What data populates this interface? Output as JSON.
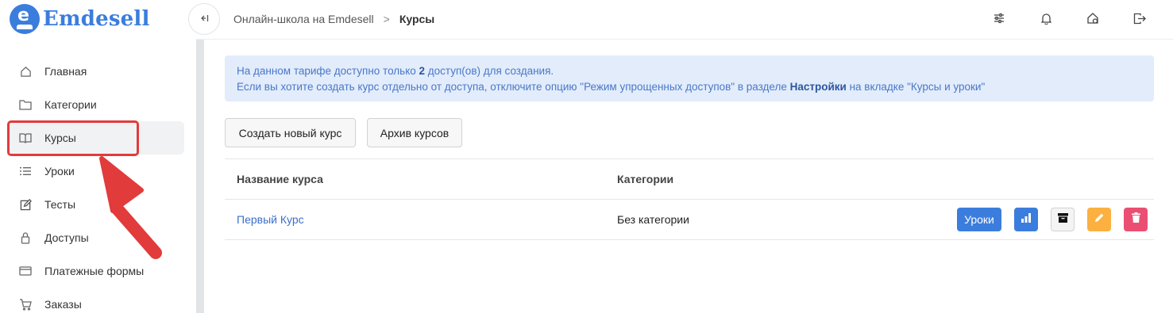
{
  "brand": {
    "name": "Emdesell",
    "mark_letter": "e",
    "color": "#3b7ddd"
  },
  "sidebar": {
    "items": [
      {
        "label": "Главная",
        "icon": "home-icon"
      },
      {
        "label": "Категории",
        "icon": "folder-icon"
      },
      {
        "label": "Курсы",
        "icon": "book-icon",
        "active": true
      },
      {
        "label": "Уроки",
        "icon": "list-icon"
      },
      {
        "label": "Тесты",
        "icon": "edit-icon"
      },
      {
        "label": "Доступы",
        "icon": "lock-icon"
      },
      {
        "label": "Платежные формы",
        "icon": "credit-card-icon"
      },
      {
        "label": "Заказы",
        "icon": "cart-icon"
      }
    ]
  },
  "topbar": {
    "collapse_icon": "collapse-left-icon",
    "breadcrumb": {
      "parent": "Онлайн-школа на Emdesell",
      "separator": ">",
      "current": "Курсы"
    },
    "icons": [
      "settings-sliders-icon",
      "bell-icon",
      "home-settings-icon",
      "logout-icon"
    ]
  },
  "alert": {
    "line1_pre": "На данном тарифе доступно только ",
    "line1_bold": "2",
    "line1_post": " доступ(ов) для создания.",
    "line2_pre": "Если вы хотите создать курс отдельно от доступа, отключите опцию \"Режим упрощенных доступов\" в разделе ",
    "line2_bold": "Настройки",
    "line2_post": " на вкладке \"Курсы и уроки\""
  },
  "actions": {
    "create_label": "Создать новый курс",
    "archive_label": "Архив курсов"
  },
  "table": {
    "headers": [
      "Название курса",
      "Категории"
    ],
    "rows": [
      {
        "name": "Первый Курс",
        "category": "Без категории",
        "lessons_label": "Уроки"
      }
    ]
  },
  "colors": {
    "primary": "#3b7ddd",
    "warning": "#fcb040",
    "danger": "#ea4f73",
    "annotation": "#e23b3b"
  }
}
